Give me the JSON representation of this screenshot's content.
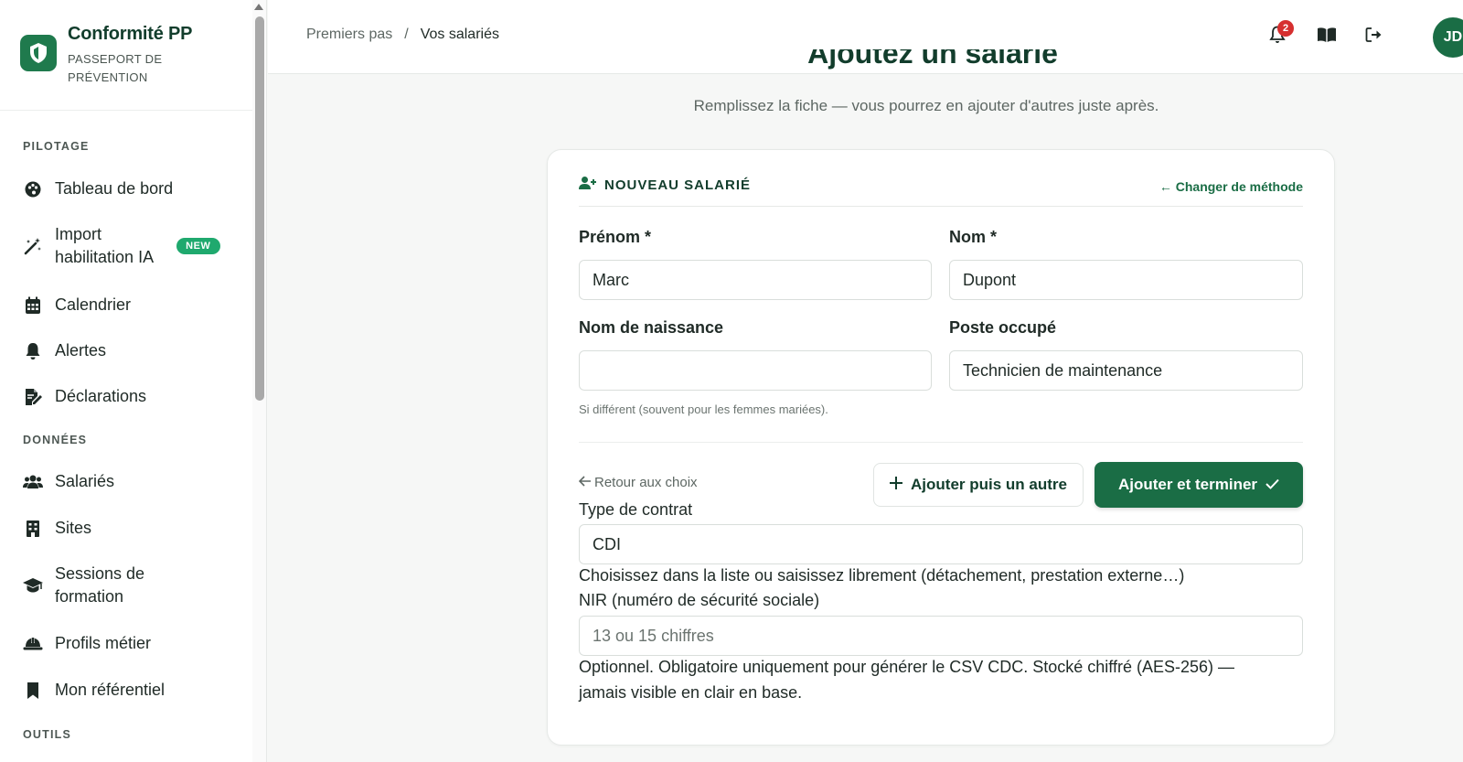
{
  "brand": {
    "title": "Conformité PP",
    "subtitle_line1": "PASSEPORT DE",
    "subtitle_line2": "PRÉVENTION"
  },
  "sidebar": {
    "sections": {
      "pilotage": "PILOTAGE",
      "donnees": "DONNÉES",
      "outils": "OUTILS"
    },
    "items": [
      {
        "label": "Tableau de bord",
        "icon": "palette-icon"
      },
      {
        "label_line1": "Import",
        "label_line2": "habilitation IA",
        "badge": "NEW",
        "icon": "magic-wand-icon"
      },
      {
        "label": "Calendrier",
        "icon": "calendar-icon"
      },
      {
        "label": "Alertes",
        "icon": "bell-icon"
      },
      {
        "label": "Déclarations",
        "icon": "file-signature-icon"
      },
      {
        "label": "Salariés",
        "icon": "users-icon"
      },
      {
        "label": "Sites",
        "icon": "building-icon"
      },
      {
        "label_line1": "Sessions de",
        "label_line2": "formation",
        "icon": "graduation-cap-icon"
      },
      {
        "label": "Profils métier",
        "icon": "hard-hat-icon"
      },
      {
        "label": "Mon référentiel",
        "icon": "bookmark-icon"
      }
    ]
  },
  "header": {
    "breadcrumb": {
      "parent": "Premiers pas",
      "separator": "/",
      "current": "Vos salariés"
    },
    "notifications_count": "2",
    "avatar_initials": "JD"
  },
  "main": {
    "title": "Ajoutez un salarié",
    "subtitle": "Remplissez la fiche — vous pourrez en ajouter d'autres juste après.",
    "card": {
      "title": "NOUVEAU SALARIÉ",
      "change_method": "← Changer de méthode",
      "fields": {
        "prenom": {
          "label": "Prénom *",
          "value": "Marc"
        },
        "nom": {
          "label": "Nom *",
          "value": "Dupont"
        },
        "nom_naissance": {
          "label": "Nom de naissance",
          "value": "",
          "hint": "Si différent (souvent pour les femmes mariées)."
        },
        "poste": {
          "label": "Poste occupé",
          "value": "Technicien de maintenance"
        },
        "contrat": {
          "label": "Type de contrat",
          "value": "CDI",
          "hint": "Choisissez dans la liste ou saisissez librement (détachement, prestation externe…)"
        },
        "nir": {
          "label": "NIR (numéro de sécurité sociale)",
          "placeholder": "13 ou 15 chiffres",
          "hint_line1": "Optionnel. Obligatoire uniquement pour générer le CSV CDC. Stocké chiffré (AES-256) —",
          "hint_line2": "jamais visible en clair en base."
        }
      },
      "actions": {
        "back": "Retour aux choix",
        "add_another": "Ajouter puis un autre",
        "add_finish": "Ajouter et terminer"
      }
    }
  },
  "colors": {
    "brand": "#1a6d45",
    "badge": "#1fa96e",
    "alert": "#d62f2f"
  }
}
